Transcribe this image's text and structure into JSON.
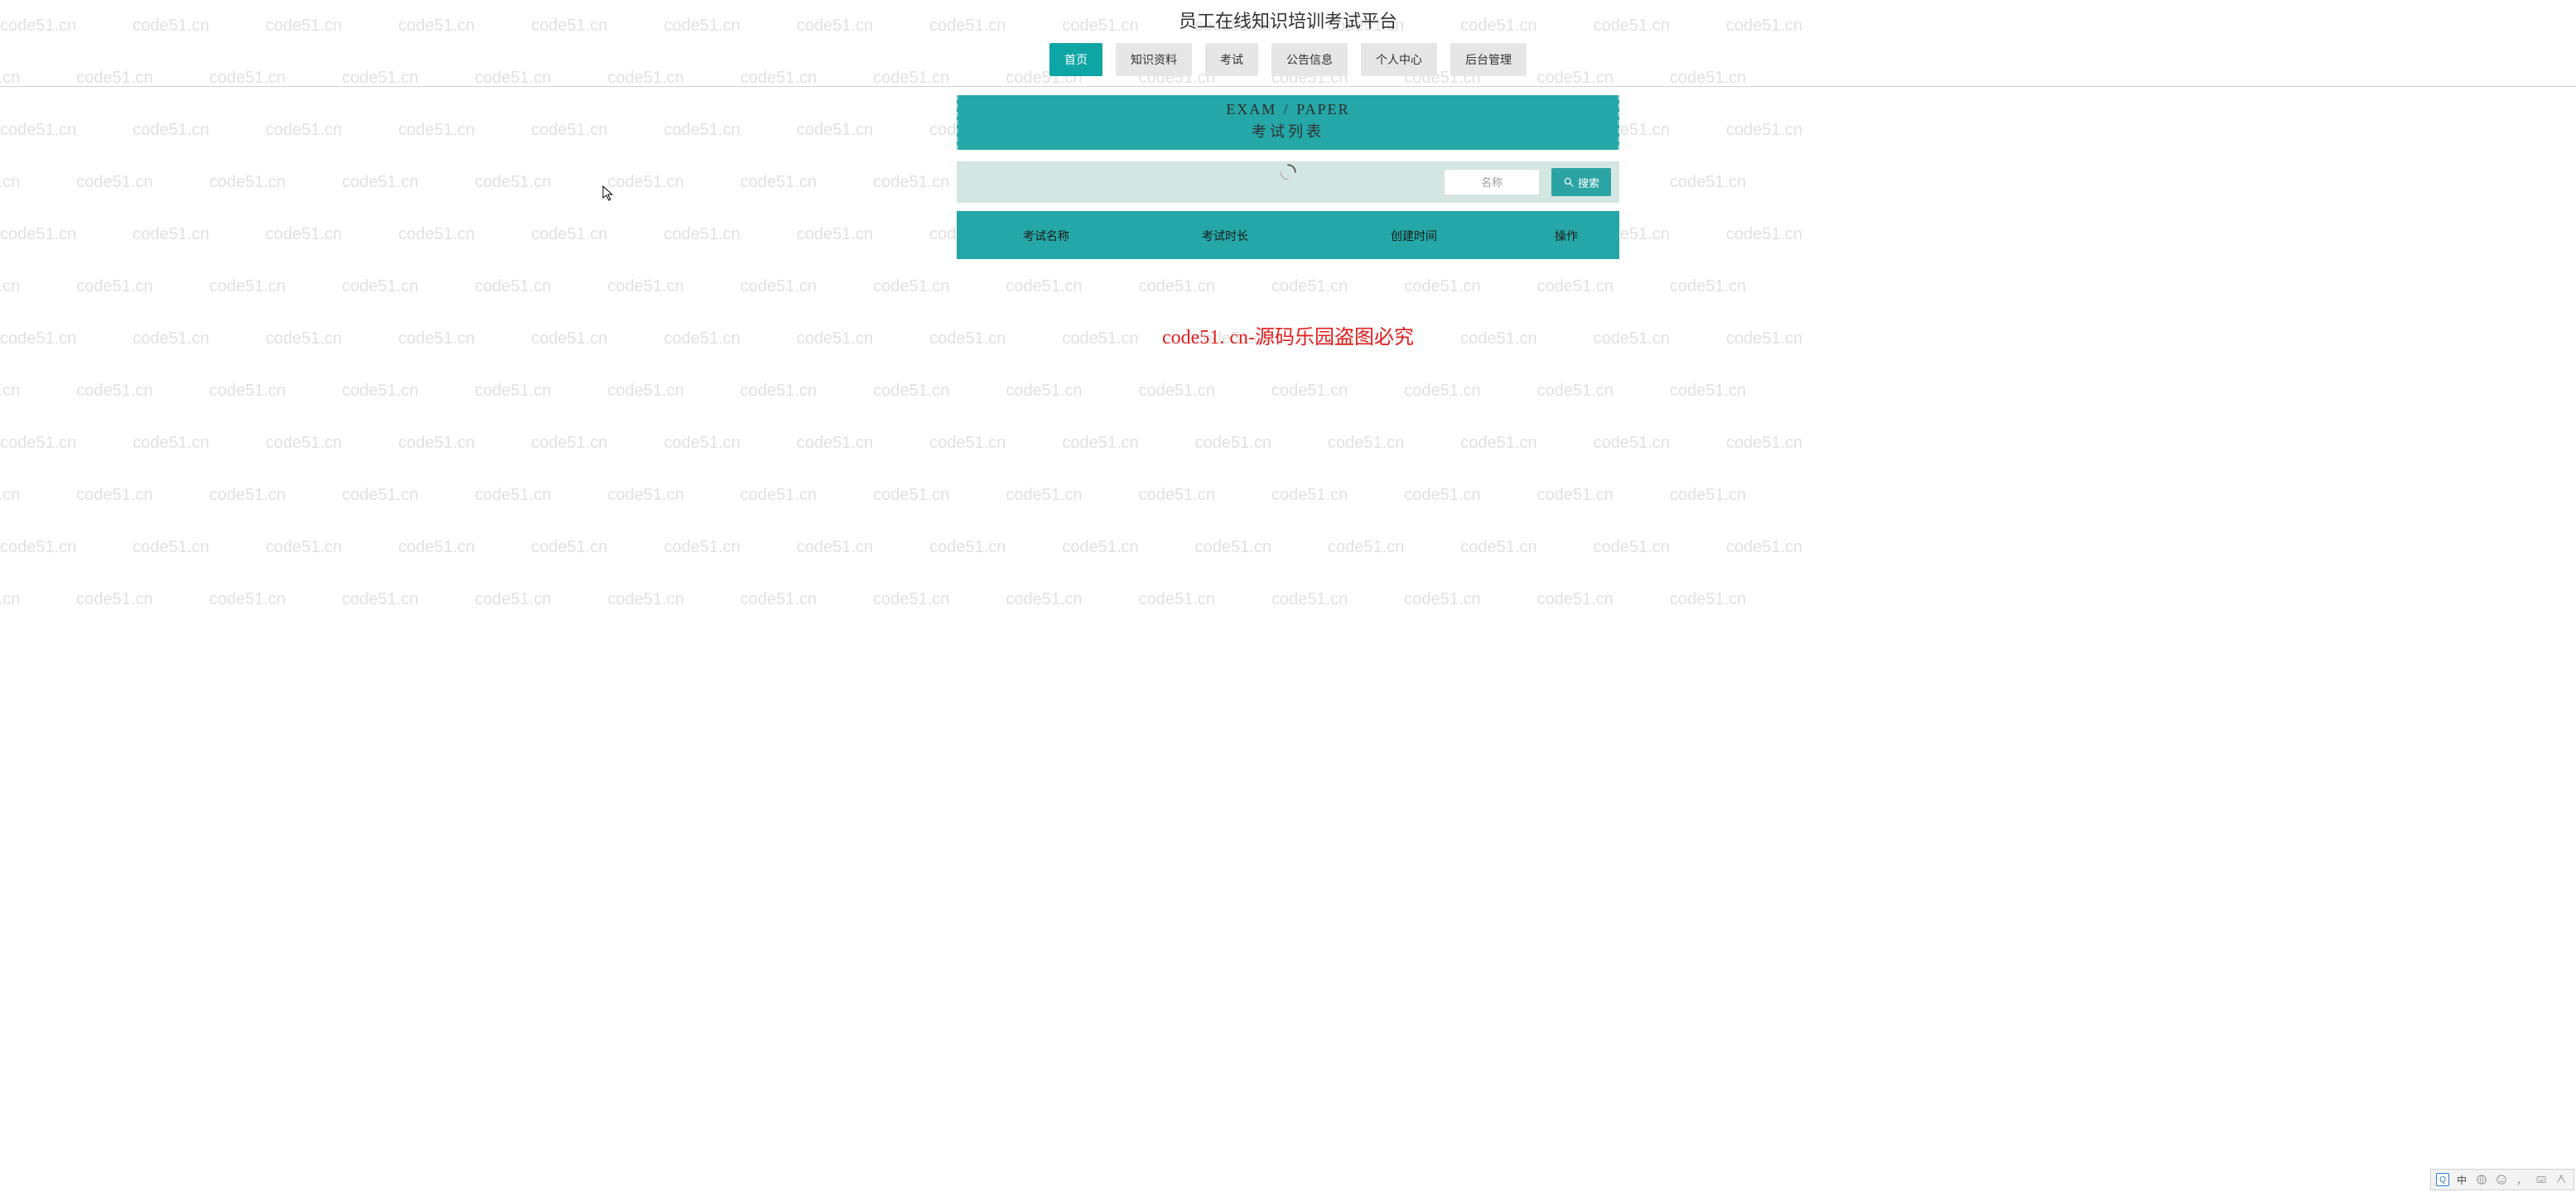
{
  "watermark_text": "code51.cn",
  "header": {
    "title": "员工在线知识培训考试平台"
  },
  "nav": {
    "items": [
      {
        "label": "首页",
        "active": true
      },
      {
        "label": "知识资料",
        "active": false
      },
      {
        "label": "考试",
        "active": false
      },
      {
        "label": "公告信息",
        "active": false
      },
      {
        "label": "个人中心",
        "active": false
      },
      {
        "label": "后台管理",
        "active": false
      }
    ]
  },
  "section": {
    "banner_en": "EXAM / PAPER",
    "banner_cn": "考试列表"
  },
  "filter": {
    "placeholder": "名称",
    "search_label": "搜索"
  },
  "table": {
    "columns": [
      {
        "key": "name",
        "label": "考试名称"
      },
      {
        "key": "duration",
        "label": "考试时长"
      },
      {
        "key": "created_at",
        "label": "创建时间"
      },
      {
        "key": "ops",
        "label": "操作"
      }
    ],
    "rows": []
  },
  "red_notice": "code51. cn-源码乐园盗图必究",
  "ime": {
    "lang": "中",
    "items": [
      "globe",
      "smile",
      "punct",
      "keyboard",
      "settings"
    ]
  }
}
